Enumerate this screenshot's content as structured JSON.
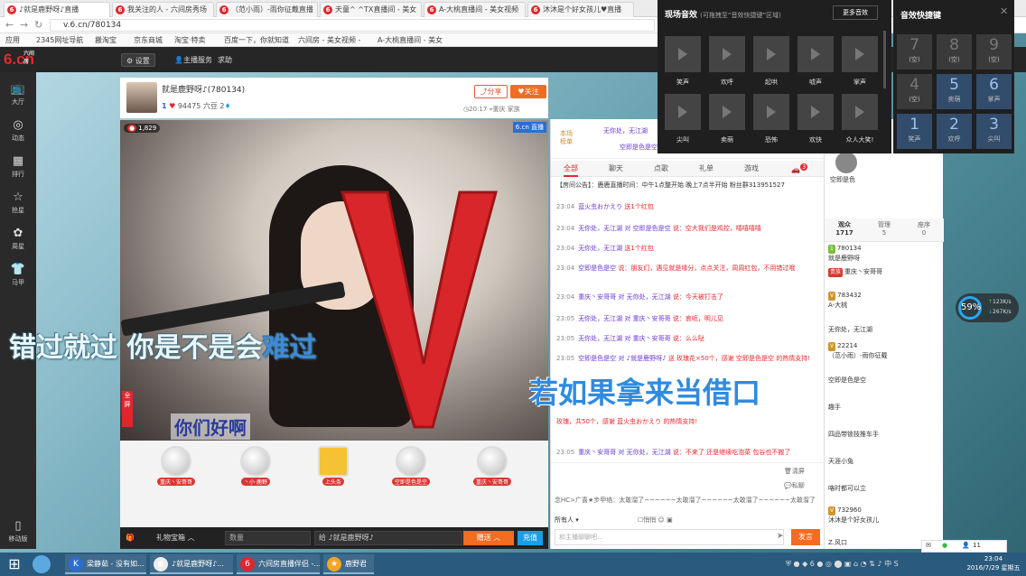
{
  "browser": {
    "tabs": [
      {
        "label": "♪就是鹿野呀♪直播",
        "active": true
      },
      {
        "label": "我关注的人 - 六间房秀场",
        "active": false
      },
      {
        "label": "（范小雨）-雨你征戴直播",
        "active": false
      },
      {
        "label": "天童^ ^TX直播间 - 美女",
        "active": false
      },
      {
        "label": "A-大桃直播间 - 美女视频",
        "active": false
      },
      {
        "label": "沐沐是个好女孩儿♥直播",
        "active": false
      }
    ],
    "url": "v.6.cn/780134",
    "bookmarks": [
      "应用",
      "2345网址导航",
      "搬淘宝",
      "京东商城",
      "淘宝·特卖",
      "百度一下，你就知道",
      "六间房 - 美女视频 -",
      "A-大桃直播间 - 美女"
    ]
  },
  "site": {
    "logo": "6.cn",
    "logo_sub": "六间房",
    "header_buttons": [
      "设置",
      "主播服务",
      "求助"
    ],
    "sidebar": [
      {
        "icon": "tv-icon",
        "label": "大厅"
      },
      {
        "icon": "compass-icon",
        "label": "动态"
      },
      {
        "icon": "ranking-icon",
        "label": "排行"
      },
      {
        "icon": "star-icon",
        "label": "抢星"
      },
      {
        "icon": "flower-icon",
        "label": "周星"
      },
      {
        "icon": "shirt-icon",
        "label": "马甲"
      },
      {
        "icon": "mobile-icon",
        "label": "移动版"
      }
    ]
  },
  "streamer": {
    "name": "就是鹿野呀♪",
    "id": "(780134)",
    "level": "1",
    "beans": "94475 六豆",
    "diamonds": "2",
    "share": "分享",
    "follow": "关注",
    "time": "20:17",
    "location": "重庆",
    "family": "家族",
    "viewers_badge": "1,829"
  },
  "video": {
    "site_badge": "6.cn",
    "live": "直播",
    "sidetab": "全屏",
    "lyric_small": "你们好啊"
  },
  "gifts": [
    {
      "name": "安哥",
      "tag": "重庆丶安哥哥"
    },
    {
      "name": "",
      "tag": "丶小·鹿野"
    },
    {
      "name": "上头条",
      "tag": "上头条"
    },
    {
      "name": "",
      "tag": "空即是色是空"
    },
    {
      "name": "安哥",
      "tag": "重庆丶安哥哥"
    }
  ],
  "giftbar": {
    "box": "礼物宝箱",
    "qty_placeholder": "数量",
    "to": "给 ♪就是鹿野呀♪",
    "send": "赠送",
    "recharge": "充值"
  },
  "chat": {
    "rank": {
      "title": "本场榜单",
      "r1": "无你处，无江湖",
      "r2": "空即是色是空"
    },
    "tabs": [
      "全部",
      "聊天",
      "点歌",
      "礼单",
      "游戏"
    ],
    "tab_badge": "3",
    "notice": "【房间公告】：鹿鹿直播时间：中午1点整开始 晚上7点半开始 粉丝群313951527",
    "messages": [
      {
        "t": "23:04",
        "n": "蓝火虫おかえり",
        "c": "送1个红包"
      },
      {
        "t": "23:04",
        "n": "无你处，无江湖 对 空即是色是空",
        "c": "说：空大我们是鸡控，嘻嘻嘻嘻"
      },
      {
        "t": "23:04",
        "n": "无你处，无江湖",
        "c": "送1个红包"
      },
      {
        "t": "23:04",
        "n": "空即是色是空",
        "c": "说：朋友们，遇见就是缘分，点点关注，周周红包，不用错过哦"
      },
      {
        "t": "23:04",
        "n": "重庆丶安哥哥 对 无你处，无江湖",
        "c": "说：今天被打击了"
      },
      {
        "t": "23:05",
        "n": "无你处，无江湖 对 重庆丶安哥哥",
        "c": "说：哀呃，明儿见"
      },
      {
        "t": "23:05",
        "n": "无你处，无江湖 对 重庆丶安哥哥",
        "c": "说：么么哒"
      },
      {
        "t": "23:05",
        "n": "空即是色是空 对 ♪就是鹿野呀♪",
        "c": "送 玫瑰花×50个，感谢 空即是色是空 的热情支持!"
      },
      {
        "t": "",
        "n": "",
        "c": "玫瑰，共50个，感谢 蓝火虫おかえり 的热情支持!"
      },
      {
        "t": "23:05",
        "n": "重庆丶安哥哥 对 无你处，无江湖",
        "c": "说：不来了 还是继续吃泡菜 包谷也不搬了"
      }
    ],
    "clear": "清屏",
    "private": "私聊",
    "broadcast": "念HC>广喜★步甲络：太敢溜了~~~~~~太敢溜了~~~~~~太敢溜了~~~~~~太敢溜了",
    "recipient": "所有人",
    "emote": "悄悄",
    "input_placeholder": "和主播聊聊吧...",
    "send": "发言"
  },
  "overlay": {
    "lyric1_a": "错过就过 你是不是会",
    "lyric1_b": "难过",
    "lyric3": "若如果拿来当借口"
  },
  "audience": {
    "guard_label": "守护",
    "guard_name": "空即是色",
    "tabs": [
      {
        "label": "观众",
        "count": "1717"
      },
      {
        "label": "管理",
        "count": "5"
      },
      {
        "label": "座序",
        "count": "0"
      }
    ],
    "list": [
      {
        "lv": "1",
        "id": "780134",
        "name": "就是鹿野呀"
      },
      {
        "lv": "贵族",
        "id": "",
        "name": "重庆丶安哥哥"
      },
      {
        "lv": "V",
        "id": "783432",
        "name": "A-大桃"
      },
      {
        "lv": "",
        "id": "",
        "name": "无你处，无江湖"
      },
      {
        "lv": "V",
        "id": "22214",
        "name": "（范小雨）-雨你征戴"
      },
      {
        "lv": "",
        "id": "",
        "name": "空即是色是空"
      },
      {
        "lv": "",
        "id": "",
        "name": "趣手"
      },
      {
        "lv": "",
        "id": "",
        "name": "四品带锁技推车手"
      },
      {
        "lv": "",
        "id": "",
        "name": "天涯小兔"
      },
      {
        "lv": "",
        "id": "",
        "name": "咯时都可以立"
      },
      {
        "lv": "V",
        "id": "732960",
        "name": "沐沐是个好女孩儿"
      },
      {
        "lv": "",
        "id": "",
        "name": "Z.风口"
      }
    ]
  },
  "sfx": {
    "title": "现场音效",
    "hint": "(可拖拽至“音效快捷键”区域)",
    "more": "更多音效",
    "row1": [
      "笑声",
      "欢呼",
      "起哄",
      "嘘声",
      "掌声"
    ],
    "row2": [
      "尖叫",
      "卖萌",
      "恐怖",
      "欢快",
      "众人大笑!"
    ]
  },
  "hotkeys": {
    "title": "音效快捷键",
    "keys": [
      {
        "d": "7",
        "l": "(空)",
        "on": false
      },
      {
        "d": "8",
        "l": "(空)",
        "on": false
      },
      {
        "d": "9",
        "l": "(空)",
        "on": false
      },
      {
        "d": "4",
        "l": "(空)",
        "on": false
      },
      {
        "d": "5",
        "l": "卖萌",
        "on": true
      },
      {
        "d": "6",
        "l": "掌声",
        "on": true
      },
      {
        "d": "1",
        "l": "笑声",
        "on": true
      },
      {
        "d": "2",
        "l": "欢呼",
        "on": true
      },
      {
        "d": "3",
        "l": "尖叫",
        "on": true
      }
    ]
  },
  "net": {
    "pct": "59%",
    "up": "123K/s",
    "down": "267K/s"
  },
  "msgpill": "11",
  "taskbar": {
    "items": [
      "梁静茹 - 没有如...",
      "♪就是鹿野呀♪...",
      "六间房直播伴侣 -...",
      "鹿野君"
    ],
    "date": "2016/7/29 星期五",
    "time": "23:04"
  }
}
